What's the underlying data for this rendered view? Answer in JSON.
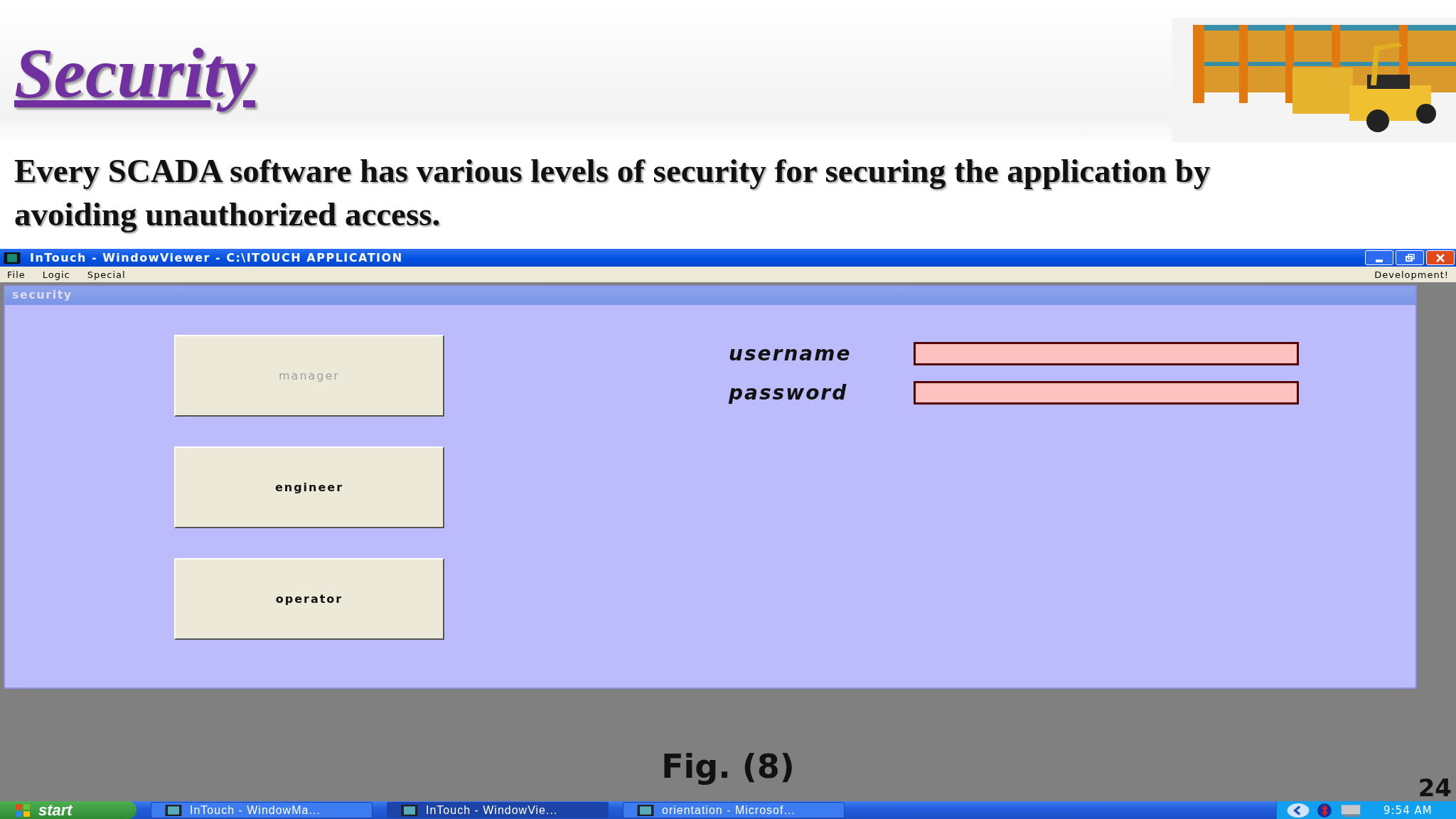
{
  "slide": {
    "title": "Security",
    "body": "Every SCADA software has various levels of security for securing the application by avoiding unauthorized access.",
    "caption": "Fig. (8)",
    "page_number": "24"
  },
  "window": {
    "title": "InTouch - WindowViewer - C:\\ITOUCH APPLICATION"
  },
  "menu": [
    "File",
    "Logic",
    "Special"
  ],
  "menu_right": "Development!",
  "panel": {
    "title": "security"
  },
  "role_buttons": [
    {
      "label": "manager",
      "disabled": true
    },
    {
      "label": "engineer",
      "disabled": false
    },
    {
      "label": "operator",
      "disabled": false
    }
  ],
  "fields": [
    {
      "label": "username"
    },
    {
      "label": "password"
    }
  ],
  "taskbar": {
    "start": "start",
    "tasks": [
      {
        "label": "InTouch - WindowMa...",
        "selected": false
      },
      {
        "label": "InTouch - WindowVie...",
        "selected": true
      },
      {
        "label": "orientation - Microsof...",
        "selected": false
      }
    ],
    "clock": "9:54 AM"
  }
}
